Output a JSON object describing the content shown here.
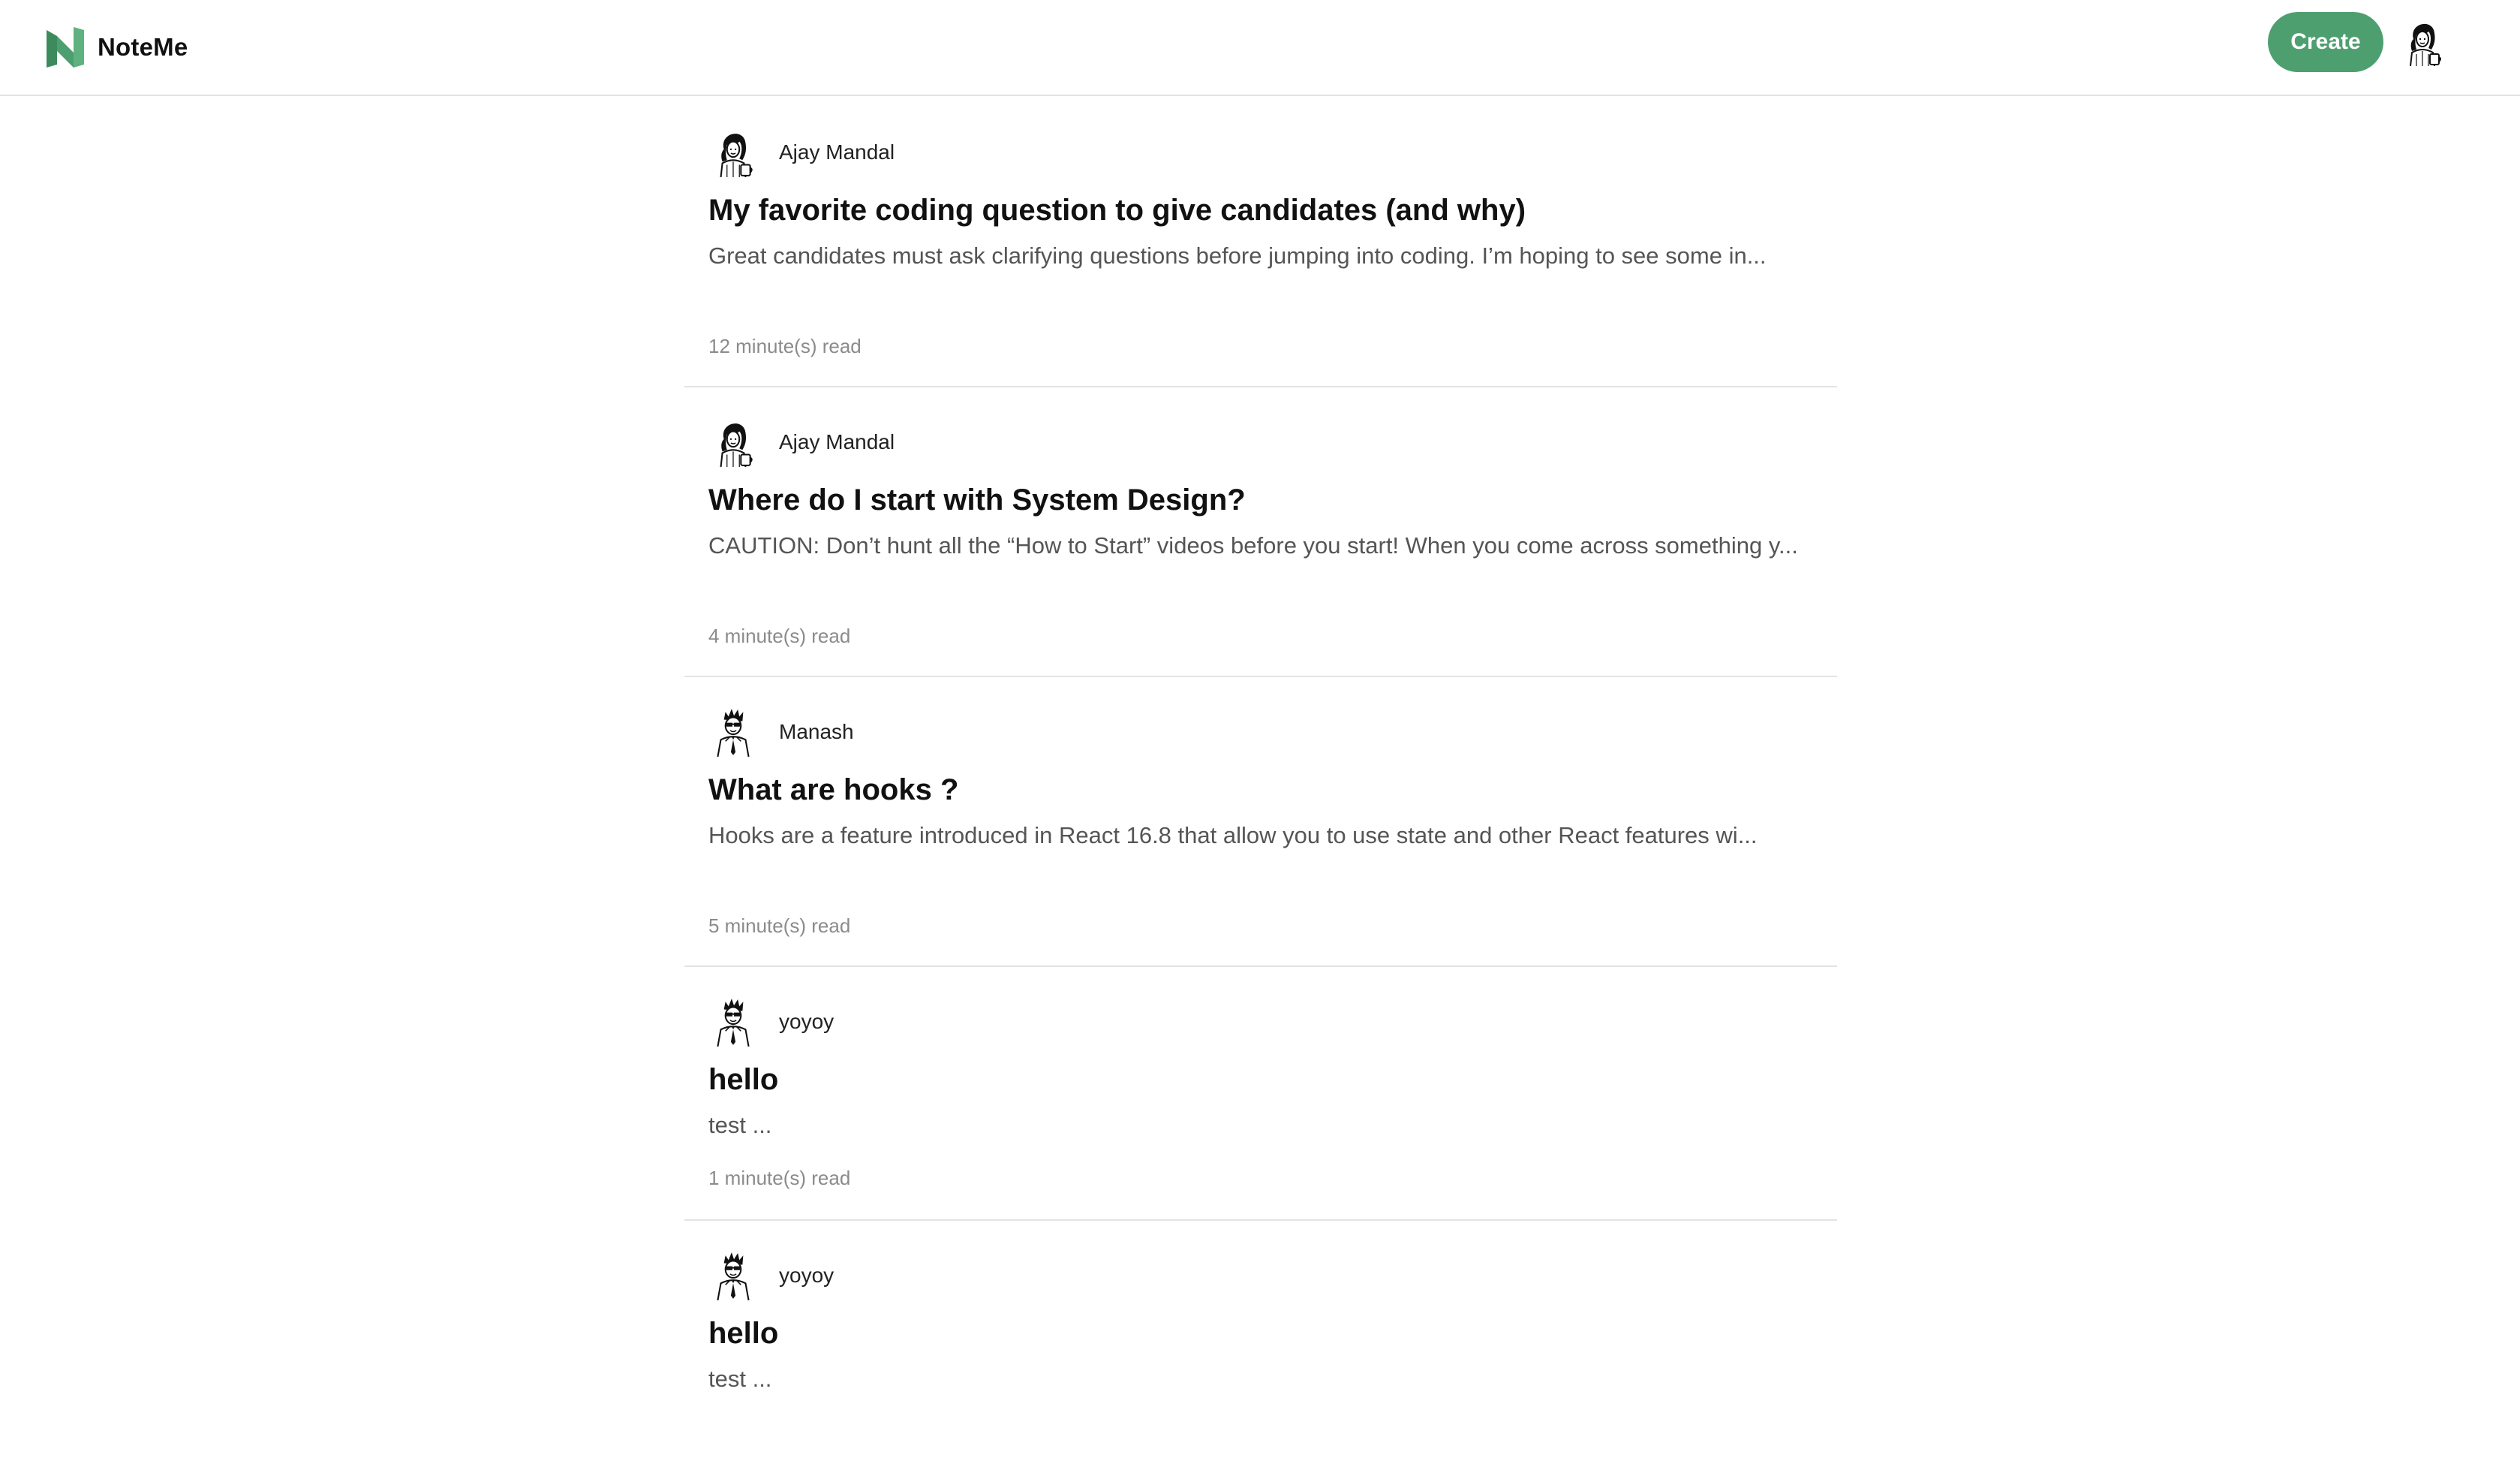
{
  "app": {
    "name": "NoteMe",
    "brand_color": "#4e9f6f"
  },
  "header": {
    "create_label": "Create",
    "user_avatar_icon": "user-avatar-woman-icon"
  },
  "posts": [
    {
      "author": "Ajay Mandal",
      "avatar": "woman-sketch",
      "title": "My favorite coding question to give candidates (and why)",
      "excerpt": "Great candidates must ask clarifying questions before jumping into coding. I’m hoping to see some in...",
      "read_time": "12 minute(s) read"
    },
    {
      "author": "Ajay Mandal",
      "avatar": "woman-sketch",
      "title": "Where do I start with System Design?",
      "excerpt": "CAUTION: Don’t hunt all the “How to Start” videos before you start! When you come across something y...",
      "read_time": "4 minute(s) read"
    },
    {
      "author": "Manash",
      "avatar": "man-sketch",
      "title": "What are hooks ?",
      "excerpt": "Hooks are a feature introduced in React 16.8 that allow you to use state and other React features wi...",
      "read_time": "5 minute(s) read"
    },
    {
      "author": "yoyoy",
      "avatar": "man-sketch",
      "title": "hello",
      "excerpt": "test ...",
      "read_time": "1 minute(s) read"
    },
    {
      "author": "yoyoy",
      "avatar": "man-sketch",
      "title": "hello",
      "excerpt": "test ...",
      "read_time": ""
    }
  ]
}
